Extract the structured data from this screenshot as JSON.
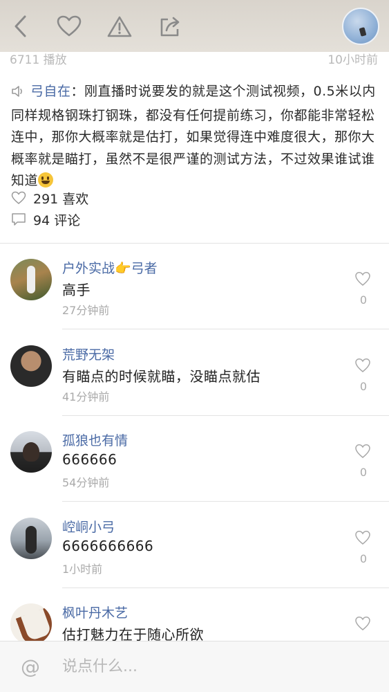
{
  "header": {
    "play_count": "6711 播放",
    "time_ago": "10小时前"
  },
  "post": {
    "author": "弓自在",
    "separator": "：",
    "text": "刚直播时说要发的就是这个测试视频，0.5米以内同样规格钢珠打钢珠，都没有任何提前练习，你都能非常轻松连中，那你大概率就是估打，如果觉得连中难度很大，那你大概率就是瞄打，虽然不是很严谨的测试方法，不过效果谁试谁知道",
    "emoji": "grinning-face"
  },
  "stats": {
    "likes": "291 喜欢",
    "comments": "94 评论"
  },
  "comments": [
    {
      "name": "户外实战👉弓者",
      "text": "高手",
      "time": "27分钟前",
      "likes": "0"
    },
    {
      "name": "荒野无架",
      "text": "有瞄点的时候就瞄，没瞄点就估",
      "time": "41分钟前",
      "likes": "0"
    },
    {
      "name": "孤狼也有情",
      "text": "666666",
      "time": "54分钟前",
      "likes": "0"
    },
    {
      "name": "崆峒小弓",
      "text": "6666666666",
      "time": "1小时前",
      "likes": "0"
    },
    {
      "name": "枫叶丹木艺",
      "text": "估打魅力在于随心所欲",
      "time": "",
      "likes": ""
    }
  ],
  "input": {
    "placeholder": "说点什么..."
  },
  "icons": {
    "back": "chevron-left-icon",
    "like": "heart-icon",
    "report": "warning-icon",
    "share": "share-icon",
    "at": "at-icon",
    "speaker": "speaker-icon",
    "comment": "comment-icon"
  },
  "colors": {
    "accent": "#4a6aa5",
    "muted": "#aaaaaa",
    "icon": "#8a8a8a"
  }
}
